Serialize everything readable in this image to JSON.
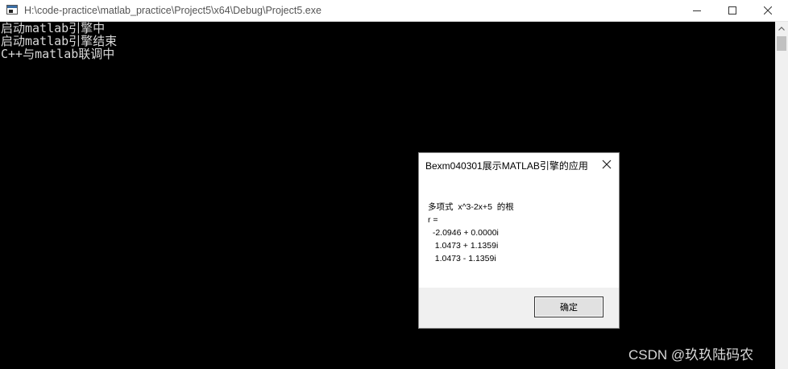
{
  "window": {
    "title": "H:\\code-practice\\matlab_practice\\Project5\\x64\\Debug\\Project5.exe",
    "app_icon": "console-app-icon",
    "controls": [
      "minimize-icon",
      "maximize-icon",
      "close-icon"
    ]
  },
  "console": {
    "lines": [
      "启动matlab引擎中",
      "启动matlab引擎结束",
      "C++与matlab联调中"
    ],
    "text_color": "#d9d9d9",
    "background": "#000000"
  },
  "dialog": {
    "title": "Bexm040301展示MATLAB引擎的应用",
    "close_icon": "close-icon",
    "body_lines": [
      "多项式  x^3-2x+5  的根",
      "r =",
      "  -2.0946 + 0.0000i",
      "   1.0473 + 1.1359i",
      "   1.0473 - 1.1359i"
    ],
    "ok_label": "确定"
  },
  "watermark": {
    "text": "CSDN @玖玖陆码农"
  }
}
